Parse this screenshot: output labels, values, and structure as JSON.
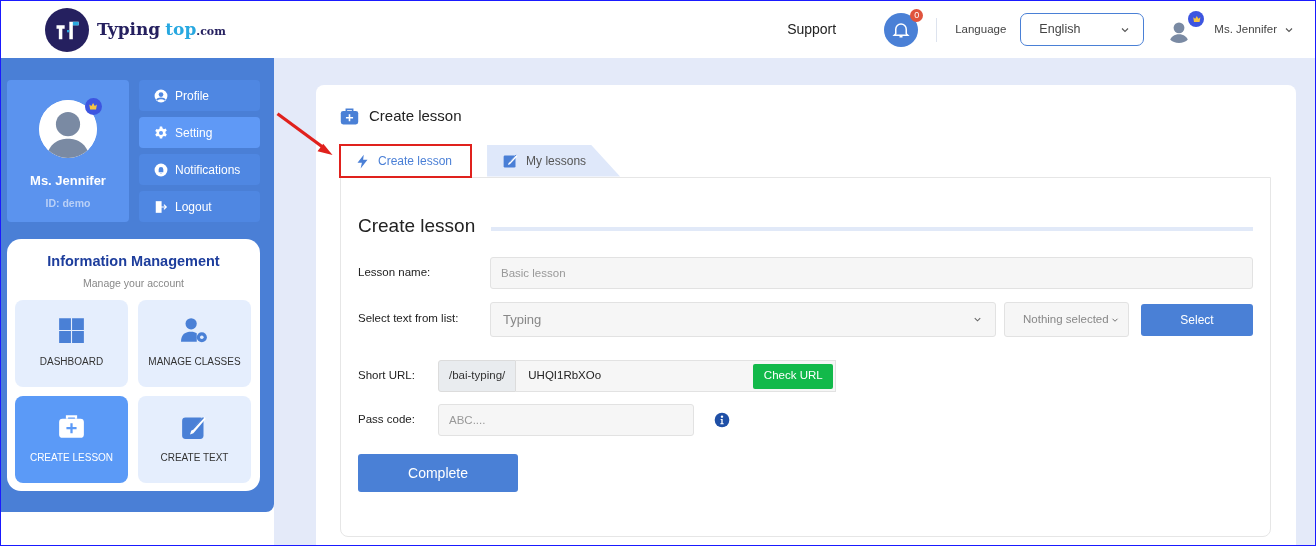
{
  "header": {
    "logo": {
      "word_1": "Typing",
      "word_2": "top",
      "word_3": ".com"
    },
    "support": "Support",
    "notification_count": "0",
    "language_label": "Language",
    "language": "English",
    "user_name": "Ms. Jennifer"
  },
  "sidebar": {
    "profile": {
      "name": "Ms. Jennifer",
      "id": "ID: demo"
    },
    "menu": [
      {
        "label": "Profile",
        "kind": "user",
        "selected": false
      },
      {
        "label": "Setting",
        "kind": "gear",
        "selected": true
      },
      {
        "label": "Notifications",
        "kind": "bell",
        "selected": false
      },
      {
        "label": "Logout",
        "kind": "logout",
        "selected": false
      }
    ],
    "info": {
      "title": "Information Management",
      "subtitle": "Manage your account",
      "tiles": [
        {
          "label": "DASHBOARD",
          "kind": "grid",
          "selected": false
        },
        {
          "label": "MANAGE CLASSES",
          "kind": "user-gear",
          "selected": false
        },
        {
          "label": "CREATE LESSON",
          "kind": "case",
          "selected": true
        },
        {
          "label": "CREATE TEXT",
          "kind": "pen",
          "selected": false
        }
      ]
    }
  },
  "main": {
    "title": "Create lesson",
    "tabs": [
      {
        "label": "Create lesson",
        "kind": "bolt",
        "selected": true,
        "highlighted": true
      },
      {
        "label": "My lessons",
        "kind": "edit",
        "selected": false,
        "highlighted": false
      }
    ],
    "form": {
      "heading": "Create lesson",
      "lesson_name": {
        "label": "Lesson name:",
        "placeholder": "Basic lesson"
      },
      "text_list": {
        "label": "Select text from list:",
        "value": "Typing",
        "filter": "Nothing selected",
        "button": "Select"
      },
      "short_url": {
        "label": "Short URL:",
        "prefix": "/bai-typing/",
        "value": "UHQI1RbXOo",
        "button": "Check URL"
      },
      "pass_code": {
        "label": "Pass code:",
        "placeholder": "ABC...."
      },
      "submit": "Complete"
    }
  }
}
